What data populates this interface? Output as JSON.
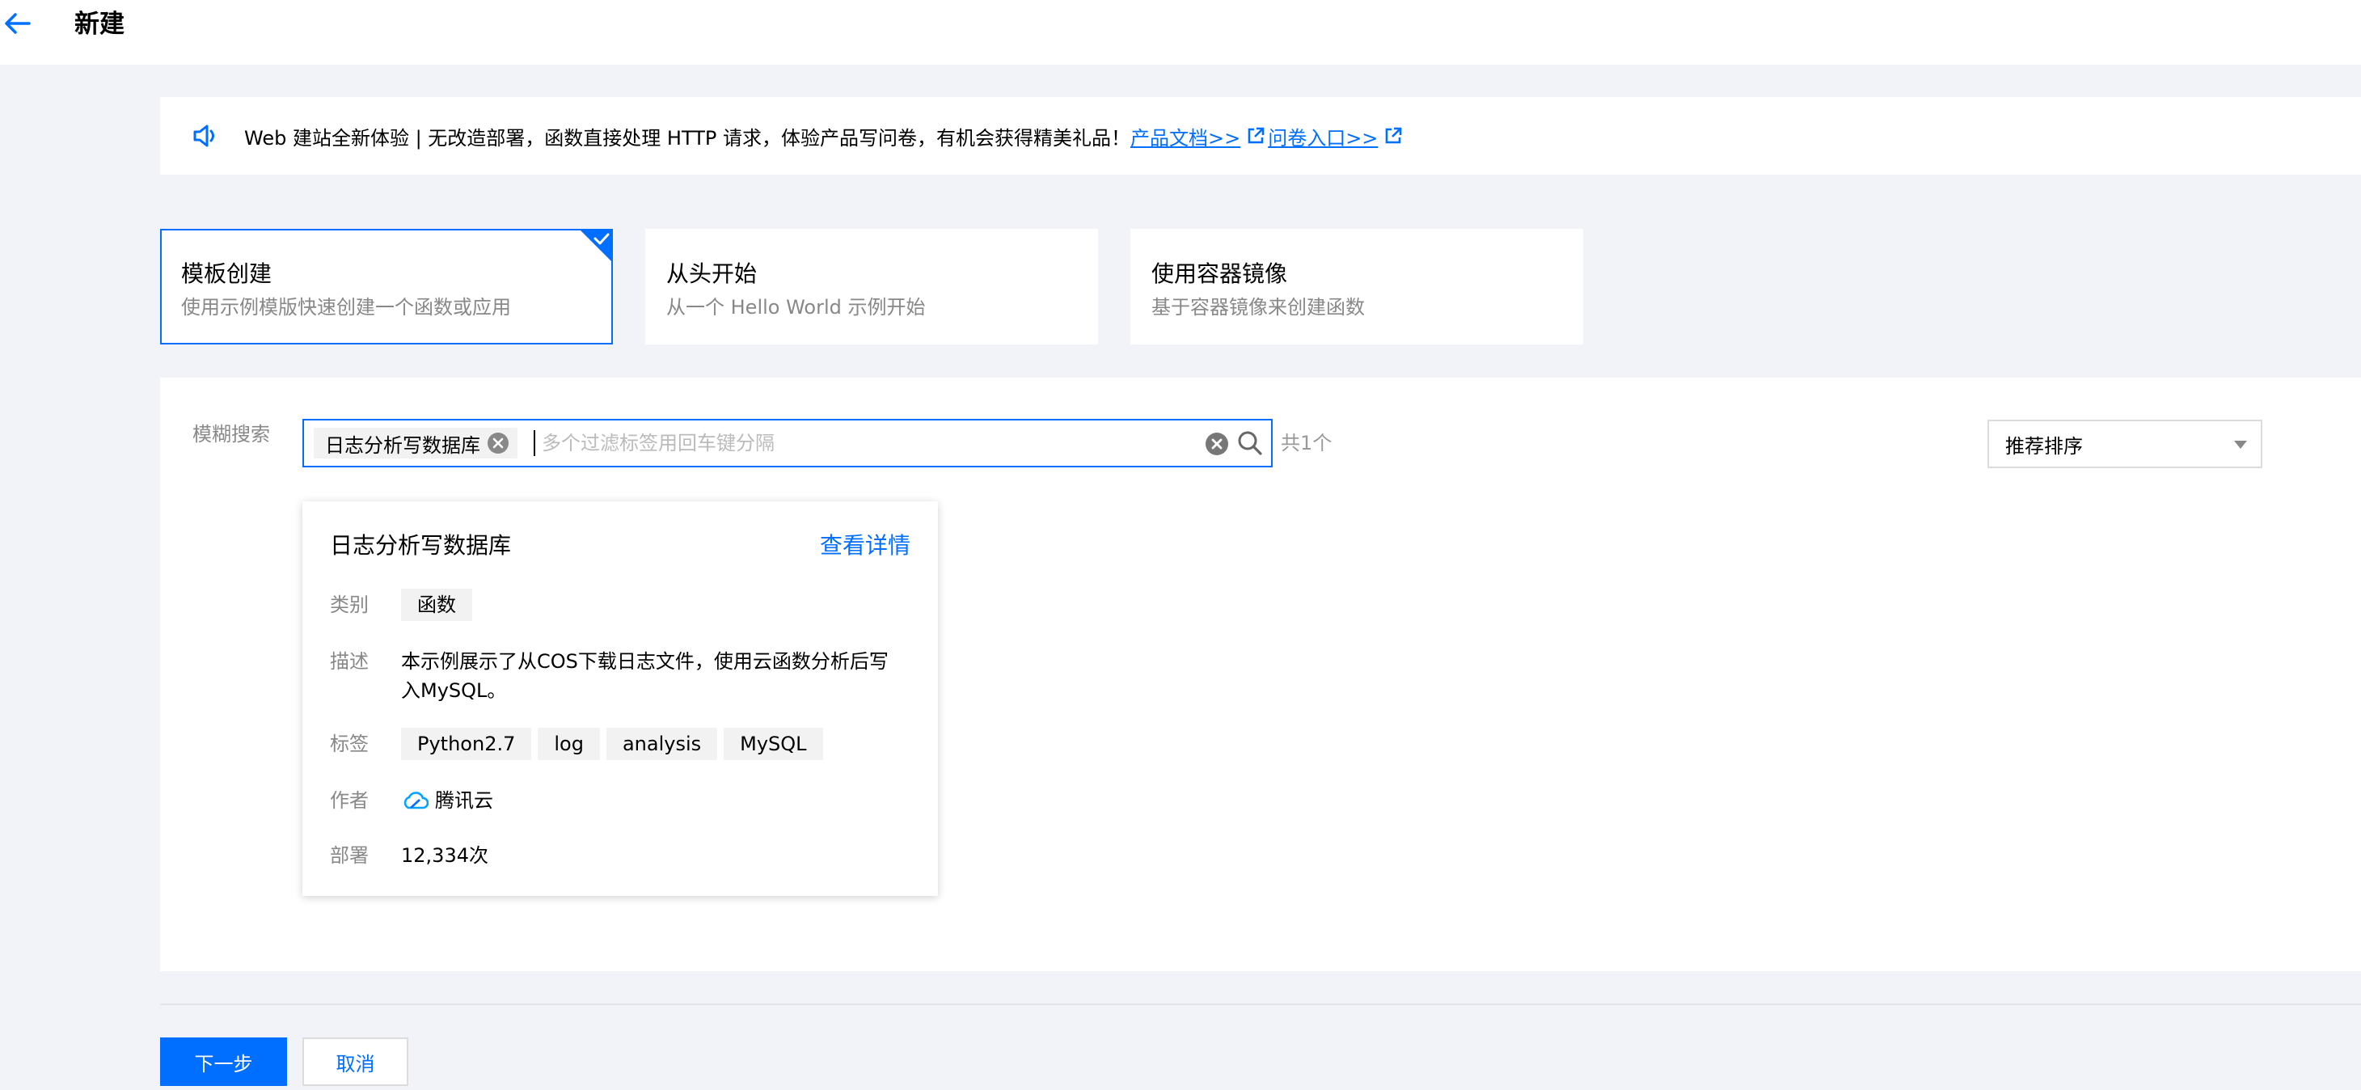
{
  "header": {
    "title": "新建"
  },
  "notice": {
    "text": "Web 建站全新体验 | 无改造部署，函数直接处理 HTTP 请求，体验产品写问卷，有机会获得精美礼品！",
    "link_docs": "产品文档>>",
    "link_survey": "问卷入口>>"
  },
  "modes": [
    {
      "title": "模板创建",
      "desc": "使用示例模版快速创建一个函数或应用",
      "selected": true
    },
    {
      "title": "从头开始",
      "desc": "从一个 Hello World 示例开始",
      "selected": false
    },
    {
      "title": "使用容器镜像",
      "desc": "基于容器镜像来创建函数",
      "selected": false
    }
  ],
  "search": {
    "label": "模糊搜索",
    "tag": "日志分析写数据库",
    "placeholder": "多个过滤标签用回车键分隔",
    "count": "共1个"
  },
  "sort": {
    "selected": "推荐排序"
  },
  "template": {
    "title": "日志分析写数据库",
    "detail_link": "查看详情",
    "category_label": "类别",
    "category": "函数",
    "desc_label": "描述",
    "desc": "本示例展示了从COS下载日志文件，使用云函数分析后写入MySQL。",
    "tags_label": "标签",
    "tags": [
      "Python2.7",
      "log",
      "analysis",
      "MySQL"
    ],
    "author_label": "作者",
    "author": "腾讯云",
    "deploy_label": "部署",
    "deploy_count": "12,334次"
  },
  "footer": {
    "next": "下一步",
    "cancel": "取消"
  },
  "colors": {
    "accent": "#006eff",
    "background": "#f2f3f8"
  }
}
